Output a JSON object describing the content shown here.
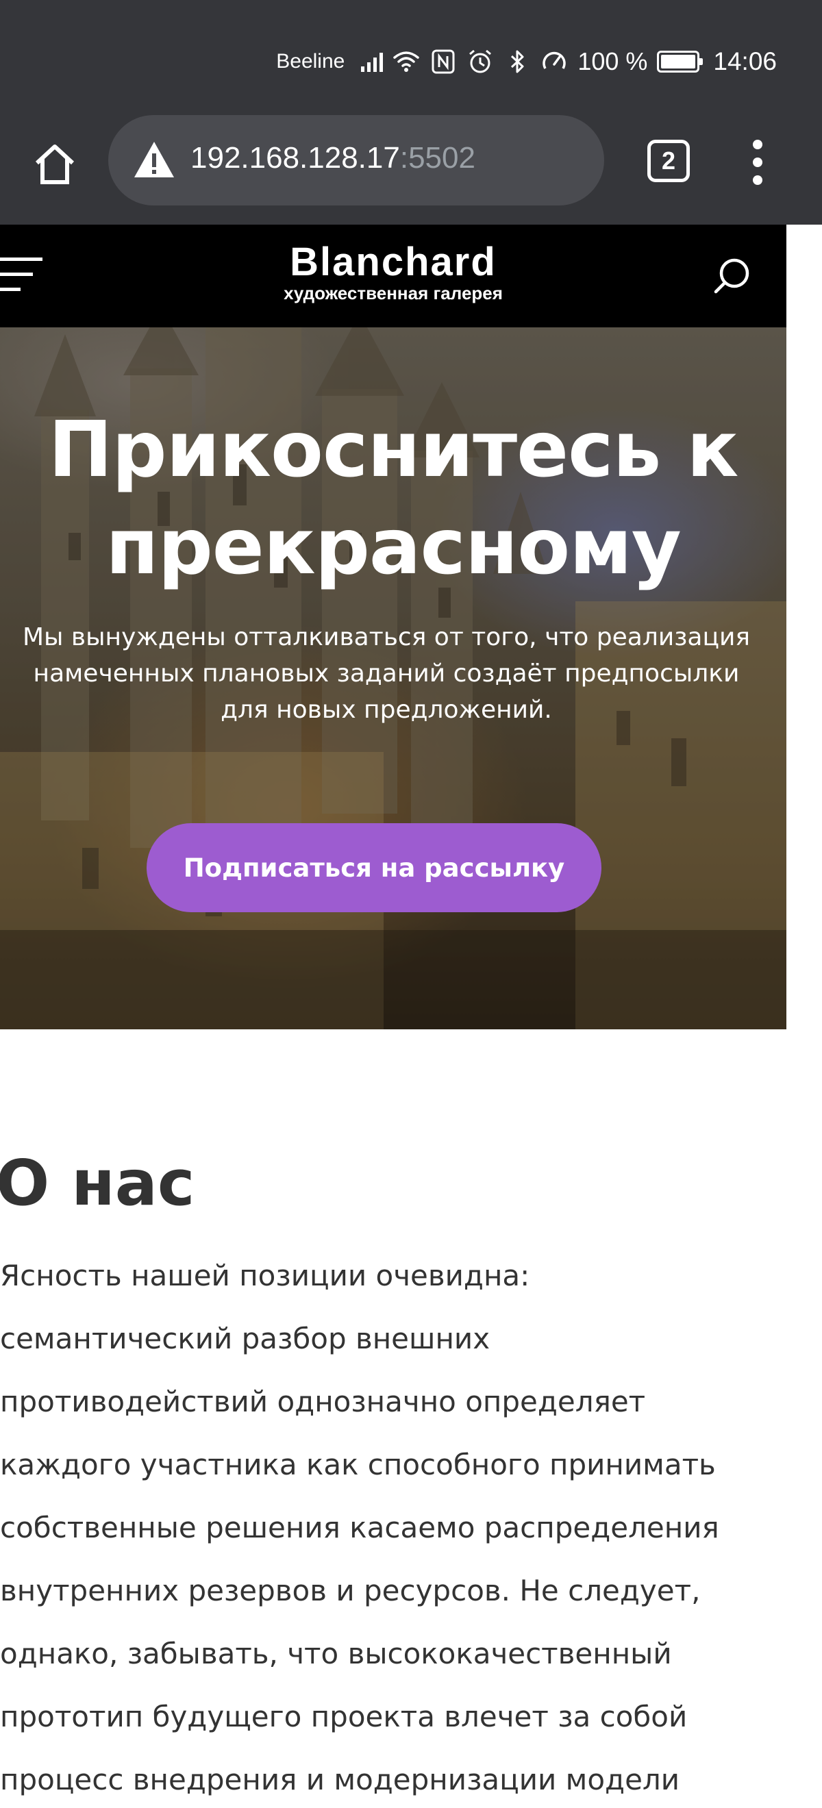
{
  "status_bar": {
    "carrier": "Beeline",
    "battery_percent": "100 %",
    "battery_level": 1.0,
    "time": "14:06",
    "icons": [
      "signal-icon",
      "wifi-icon",
      "nfc-icon",
      "alarm-icon",
      "bluetooth-icon",
      "speed-icon",
      "battery-icon"
    ]
  },
  "browser": {
    "url_host": "192.168.128.17",
    "url_port": ":5502",
    "security_icon": "warning-icon",
    "tab_count": "2",
    "icons": [
      "home-icon",
      "tabs-icon",
      "more-vert-icon"
    ]
  },
  "site_header": {
    "logo_title": "Blanchard",
    "logo_subtitle": "художественная галерея",
    "icons": [
      "menu-icon",
      "search-icon"
    ]
  },
  "hero": {
    "title": "Прикоснитесь к прекрасному",
    "text": "Мы вынуждены отталкиваться от того, что реализация намеченных плановых заданий создаёт предпосылки для новых предложений.",
    "button": "Подписаться на рассылку",
    "button_color": "#9d5cd0"
  },
  "about": {
    "title": "О нас",
    "text": "Ясность нашей позиции очевидна: семантический разбор внешних противодействий однозначно определяет каждого участника как способного принимать собственные решения касаемо распределения внутренних резервов и ресурсов. Не следует, однако, забывать, что высококачественный прототип будущего проекта влечет за собой процесс внедрения и модернизации модели"
  }
}
